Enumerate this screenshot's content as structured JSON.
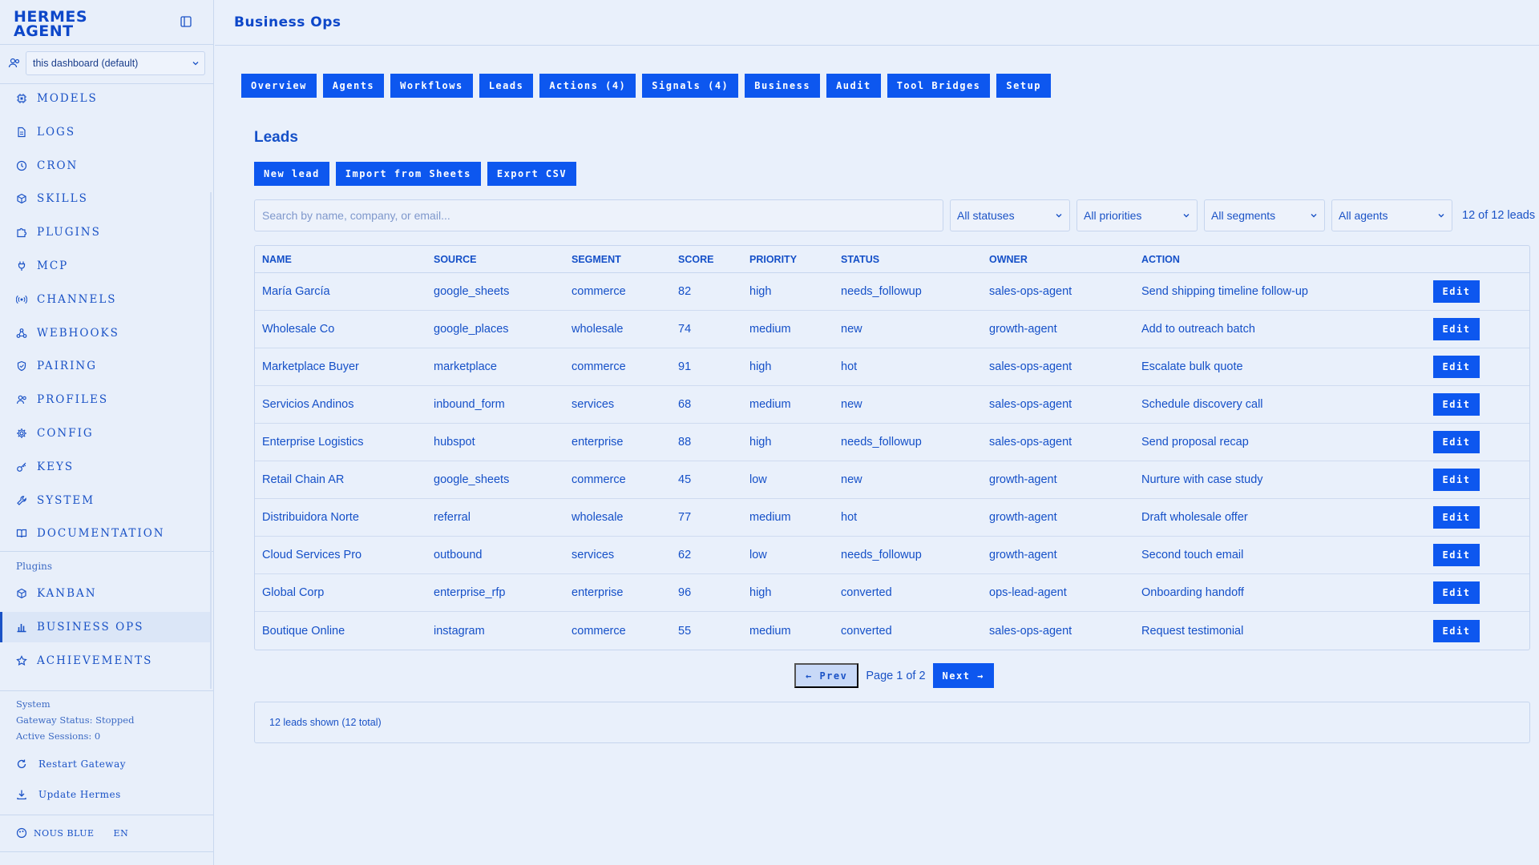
{
  "app": {
    "logo_line1": "HERMES",
    "logo_line2": "AGENT"
  },
  "workspace": {
    "selected": "this dashboard (default)"
  },
  "sidebar": {
    "items": [
      {
        "label": "MODELS",
        "icon": "cpu-icon"
      },
      {
        "label": "LOGS",
        "icon": "file-icon"
      },
      {
        "label": "CRON",
        "icon": "clock-icon"
      },
      {
        "label": "SKILLS",
        "icon": "package-icon"
      },
      {
        "label": "PLUGINS",
        "icon": "puzzle-icon"
      },
      {
        "label": "MCP",
        "icon": "plug-icon"
      },
      {
        "label": "CHANNELS",
        "icon": "radio-icon"
      },
      {
        "label": "WEBHOOKS",
        "icon": "webhook-icon"
      },
      {
        "label": "PAIRING",
        "icon": "shield-icon"
      },
      {
        "label": "PROFILES",
        "icon": "users-icon"
      },
      {
        "label": "CONFIG",
        "icon": "gear-icon"
      },
      {
        "label": "KEYS",
        "icon": "key-icon"
      },
      {
        "label": "SYSTEM",
        "icon": "wrench-icon"
      },
      {
        "label": "DOCUMENTATION",
        "icon": "book-icon"
      }
    ],
    "plugins_heading": "Plugins",
    "plugin_items": [
      {
        "label": "KANBAN",
        "icon": "package-icon"
      },
      {
        "label": "BUSINESS OPS",
        "icon": "bar-chart-icon",
        "active": true
      },
      {
        "label": "ACHIEVEMENTS",
        "icon": "star-icon"
      }
    ],
    "system": {
      "heading": "System",
      "gateway_status": "Gateway Status: Stopped",
      "active_sessions": "Active Sessions: 0",
      "restart": "Restart Gateway",
      "update": "Update Hermes"
    },
    "theme": "NOUS BLUE",
    "lang": "EN"
  },
  "header": {
    "title": "Business Ops"
  },
  "tabs": [
    "Overview",
    "Agents",
    "Workflows",
    "Leads",
    "Actions (4)",
    "Signals (4)",
    "Business",
    "Audit",
    "Tool Bridges",
    "Setup"
  ],
  "leads": {
    "heading": "Leads",
    "buttons": {
      "new": "New lead",
      "import": "Import from Sheets",
      "export": "Export CSV"
    },
    "search_placeholder": "Search by name, company, or email...",
    "filters": {
      "status": "All statuses",
      "priority": "All priorities",
      "segment": "All segments",
      "agent": "All agents"
    },
    "count_text": "12 of 12 leads",
    "columns": [
      "NAME",
      "SOURCE",
      "SEGMENT",
      "SCORE",
      "PRIORITY",
      "STATUS",
      "OWNER",
      "ACTION"
    ],
    "edit_label": "Edit",
    "rows": [
      {
        "name": "María García",
        "source": "google_sheets",
        "segment": "commerce",
        "score": "82",
        "priority": "high",
        "status": "needs_followup",
        "owner": "sales-ops-agent",
        "action": "Send shipping timeline follow-up"
      },
      {
        "name": "Wholesale Co",
        "source": "google_places",
        "segment": "wholesale",
        "score": "74",
        "priority": "medium",
        "status": "new",
        "owner": "growth-agent",
        "action": "Add to outreach batch"
      },
      {
        "name": "Marketplace Buyer",
        "source": "marketplace",
        "segment": "commerce",
        "score": "91",
        "priority": "high",
        "status": "hot",
        "owner": "sales-ops-agent",
        "action": "Escalate bulk quote"
      },
      {
        "name": "Servicios Andinos",
        "source": "inbound_form",
        "segment": "services",
        "score": "68",
        "priority": "medium",
        "status": "new",
        "owner": "sales-ops-agent",
        "action": "Schedule discovery call"
      },
      {
        "name": "Enterprise Logistics",
        "source": "hubspot",
        "segment": "enterprise",
        "score": "88",
        "priority": "high",
        "status": "needs_followup",
        "owner": "sales-ops-agent",
        "action": "Send proposal recap"
      },
      {
        "name": "Retail Chain AR",
        "source": "google_sheets",
        "segment": "commerce",
        "score": "45",
        "priority": "low",
        "status": "new",
        "owner": "growth-agent",
        "action": "Nurture with case study"
      },
      {
        "name": "Distribuidora Norte",
        "source": "referral",
        "segment": "wholesale",
        "score": "77",
        "priority": "medium",
        "status": "hot",
        "owner": "growth-agent",
        "action": "Draft wholesale offer"
      },
      {
        "name": "Cloud Services Pro",
        "source": "outbound",
        "segment": "services",
        "score": "62",
        "priority": "low",
        "status": "needs_followup",
        "owner": "growth-agent",
        "action": "Second touch email"
      },
      {
        "name": "Global Corp",
        "source": "enterprise_rfp",
        "segment": "enterprise",
        "score": "96",
        "priority": "high",
        "status": "converted",
        "owner": "ops-lead-agent",
        "action": "Onboarding handoff"
      },
      {
        "name": "Boutique Online",
        "source": "instagram",
        "segment": "commerce",
        "score": "55",
        "priority": "medium",
        "status": "converted",
        "owner": "sales-ops-agent",
        "action": "Request testimonial"
      }
    ],
    "pager": {
      "prev": "← Prev",
      "info": "Page 1 of 2",
      "next": "Next →"
    },
    "footer": "12 leads shown (12 total)"
  },
  "colors": {
    "accent": "#0d57ef",
    "text": "#1550c8",
    "background": "#e9f0fb"
  }
}
